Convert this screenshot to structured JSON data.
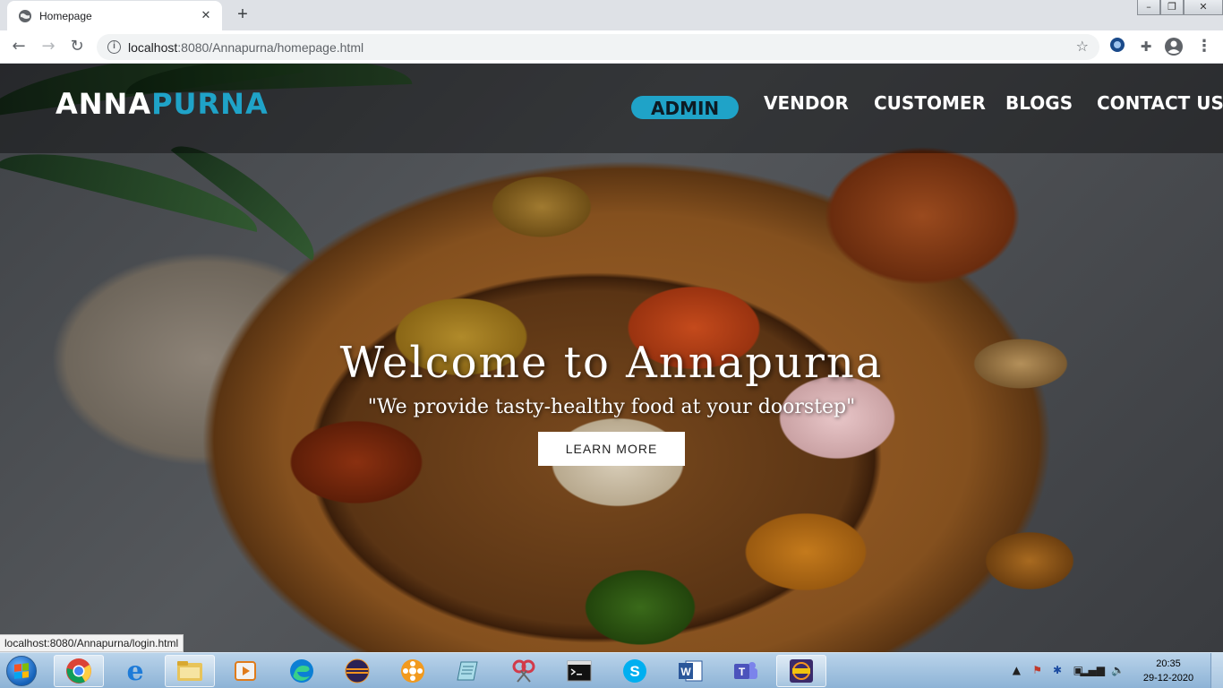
{
  "browser": {
    "tab_title": "Homepage",
    "url_host": "localhost",
    "url_rest": ":8080/Annapurna/homepage.html",
    "status_url": "localhost:8080/Annapurna/login.html"
  },
  "site": {
    "logo_part1": "ANNA",
    "logo_part2": "PURNA",
    "nav": {
      "admin": "ADMIN",
      "vendor": "VENDOR",
      "customer": "CUSTOMER",
      "blogs": "BLOGS",
      "contact": "CONTACT US"
    },
    "hero_title": "Welcome to Annapurna",
    "hero_subtitle": "\"We provide tasty-healthy food at your doorstep\"",
    "hero_button": "LEARN MORE",
    "accent_color": "#1fa3c8"
  },
  "taskbar": {
    "time": "20:35",
    "date": "29-12-2020",
    "apps": [
      "chrome-icon",
      "internet-explorer-icon",
      "file-explorer-icon",
      "media-player-icon",
      "edge-icon",
      "eclipse-icon",
      "orange-app-icon",
      "notepad-icon",
      "snipping-tool-icon",
      "command-prompt-icon",
      "skype-icon",
      "word-icon",
      "teams-icon",
      "java-ee-ide-icon"
    ]
  }
}
